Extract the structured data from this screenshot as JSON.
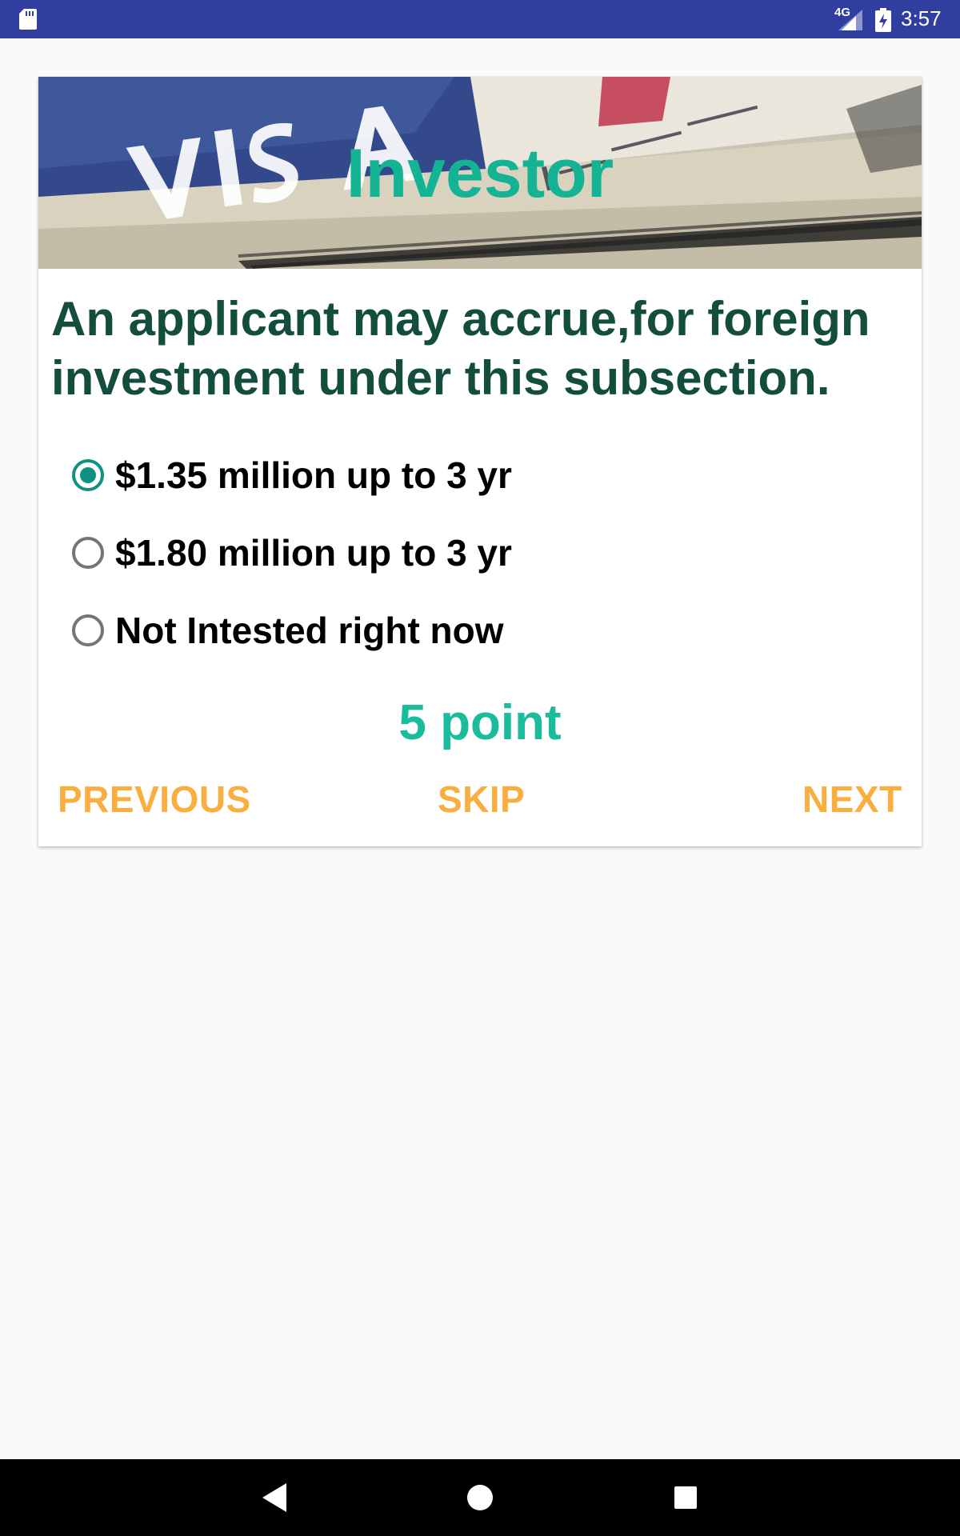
{
  "status_bar": {
    "network_label": "4G",
    "time": "3:57",
    "icons": [
      "sd-card-icon",
      "signal-icon",
      "battery-charging-icon"
    ]
  },
  "card": {
    "banner_title": "Investor",
    "question": "An applicant may accrue,for foreign investment under this subsection.",
    "options": [
      {
        "label": "$1.35 million up to 3 yr",
        "selected": true
      },
      {
        "label": "$1.80 million up to 3 yr",
        "selected": false
      },
      {
        "label": "Not Intested right now",
        "selected": false
      }
    ],
    "points": "5 point",
    "buttons": {
      "previous": "PREVIOUS",
      "skip": "SKIP",
      "next": "NEXT"
    }
  },
  "nav_bar": {
    "icons": [
      "back-icon",
      "home-icon",
      "recents-icon"
    ]
  },
  "colors": {
    "status_bar": "#303f9f",
    "accent_teal": "#14b393",
    "question_green": "#124d3d",
    "button_orange": "#f9ae3f",
    "radio_checked": "#119180"
  }
}
